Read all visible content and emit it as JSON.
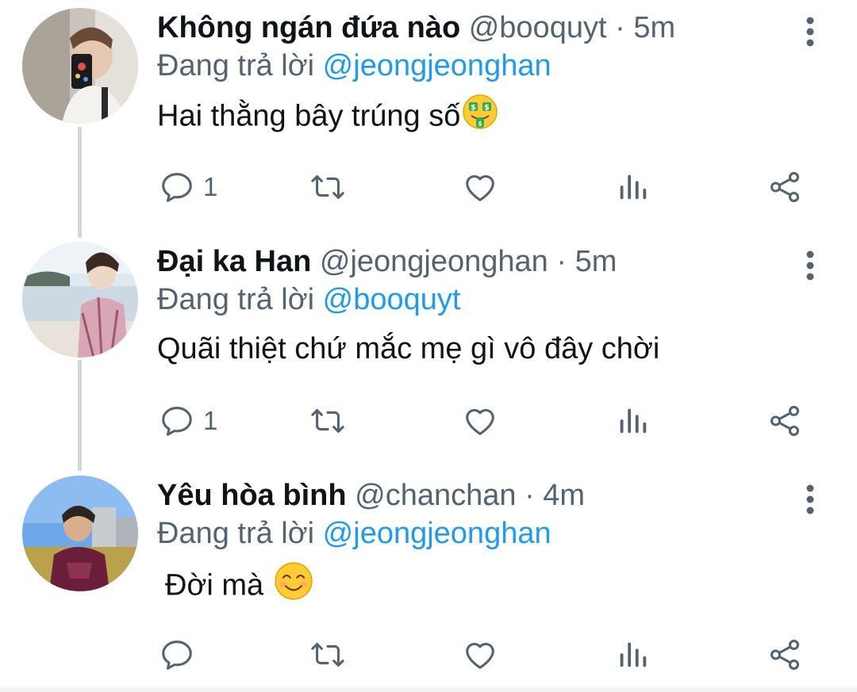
{
  "reply_prefix": "Đang trả lời",
  "colors": {
    "text": "#0f1419",
    "secondary": "#536471",
    "accent": "#1d9bf0",
    "thread_line": "#cfd9de"
  },
  "tweets": [
    {
      "name": "Không ngán đứa nào",
      "handle": "@booquyt",
      "separator": "·",
      "time": "5m",
      "reply_to": "@jeongjeonghan",
      "text": "Hai thằng bây trúng số",
      "emoji": "money-mouth-face-icon",
      "reply_count": "1"
    },
    {
      "name": "Đại ka Han",
      "handle": "@jeongjeonghan",
      "separator": "·",
      "time": "5m",
      "reply_to": "@booquyt",
      "text": "Quãi thiệt chứ mắc mẹ gì vô đây chời",
      "reply_count": "1"
    },
    {
      "name": "Yêu hòa bình",
      "handle": "@chanchan",
      "separator": "·",
      "time": "4m",
      "reply_to": "@jeongjeonghan",
      "text": "Đời mà",
      "emoji": "smiling-face-icon",
      "reply_count": ""
    }
  ]
}
